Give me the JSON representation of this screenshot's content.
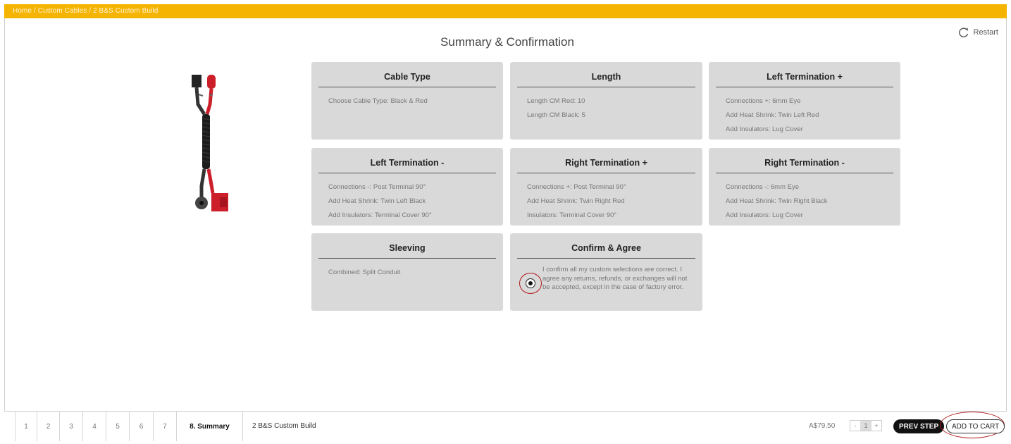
{
  "breadcrumb": "Home / Custom Cables / 2 B&S Custom Build",
  "restart_label": "Restart",
  "page_title": "Summary & Confirmation",
  "colors": {
    "brand": "#f5b400",
    "card_bg": "#d9d9d9",
    "annotation": "#b0191b"
  },
  "cards": [
    {
      "title": "Cable Type",
      "lines": [
        "Choose Cable Type: Black & Red"
      ]
    },
    {
      "title": "Length",
      "lines": [
        "Length CM Red: 10",
        "Length CM Black: 5"
      ]
    },
    {
      "title": "Left Termination +",
      "lines": [
        "Connections +: 6mm Eye",
        "Add Heat Shrink: Twin Left Red",
        "Add Insulators: Lug Cover"
      ]
    },
    {
      "title": "Left Termination -",
      "lines": [
        "Connections -: Post Terminal 90°",
        "Add Heat Shrink: Twin Left Black",
        "Add Insulators: Terminal Cover 90°"
      ]
    },
    {
      "title": "Right Termination +",
      "lines": [
        "Connections +: Post Terminal 90°",
        "Add Heat Shrink: Twin Right Red",
        "Insulators: Terminal Cover 90°"
      ]
    },
    {
      "title": "Right Termination -",
      "lines": [
        "Connections -: 6mm Eye",
        "Add Heat Shrink: Twin Right Black",
        "Add Insulators: Lug Cover"
      ]
    },
    {
      "title": "Sleeving",
      "lines": [
        "Combined: Split Conduit"
      ]
    }
  ],
  "confirm": {
    "title": "Confirm & Agree",
    "text": "I confirm all my custom selections are correct. I agree any returns, refunds, or exchanges will not be accepted, except in the case of factory error.",
    "checked": true
  },
  "steps": [
    "1",
    "2",
    "3",
    "4",
    "5",
    "6",
    "7",
    "8. Summary"
  ],
  "product_name": "2 B&S Custom Build",
  "price": "A$79.50",
  "quantity": {
    "minus": "-",
    "value": "1",
    "plus": "+"
  },
  "prev_label": "PREV STEP",
  "cart_label": "ADD TO CART"
}
